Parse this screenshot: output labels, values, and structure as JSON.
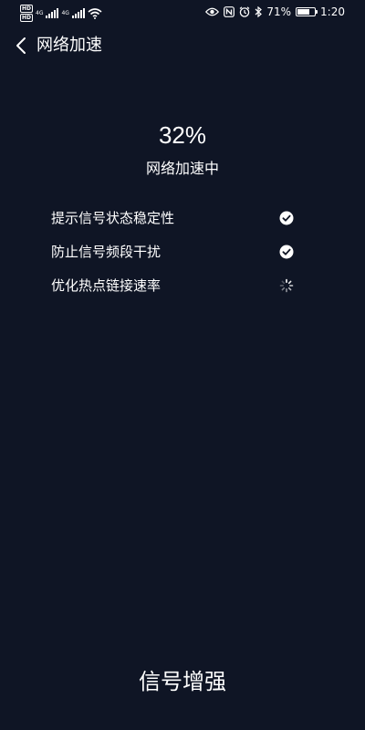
{
  "status_bar": {
    "sim1": {
      "badge": "HD",
      "net": "4G",
      "sub": "1"
    },
    "sim2": {
      "badge": "HD",
      "net": "4G",
      "sub": "2"
    },
    "battery_percent": "71%",
    "battery_level": 0.71,
    "time": "1:20",
    "icons": [
      "hd-badge-icon",
      "signal-icon",
      "wifi-icon",
      "eye-icon",
      "nfc-icon",
      "alarm-icon",
      "bluetooth-icon",
      "battery-icon"
    ]
  },
  "header": {
    "back_icon": "chevron-left-icon",
    "title": "网络加速"
  },
  "progress": {
    "percent": "32%",
    "status": "网络加速中"
  },
  "tasks": [
    {
      "label": "提示信号状态稳定性",
      "state": "done",
      "icon": "check-circle-icon"
    },
    {
      "label": "防止信号频段干扰",
      "state": "done",
      "icon": "check-circle-icon"
    },
    {
      "label": "优化热点链接速率",
      "state": "loading",
      "icon": "spinner-icon"
    }
  ],
  "bottom": {
    "label": "信号增强"
  },
  "colors": {
    "background": "#0f1525",
    "text": "#ffffff"
  }
}
